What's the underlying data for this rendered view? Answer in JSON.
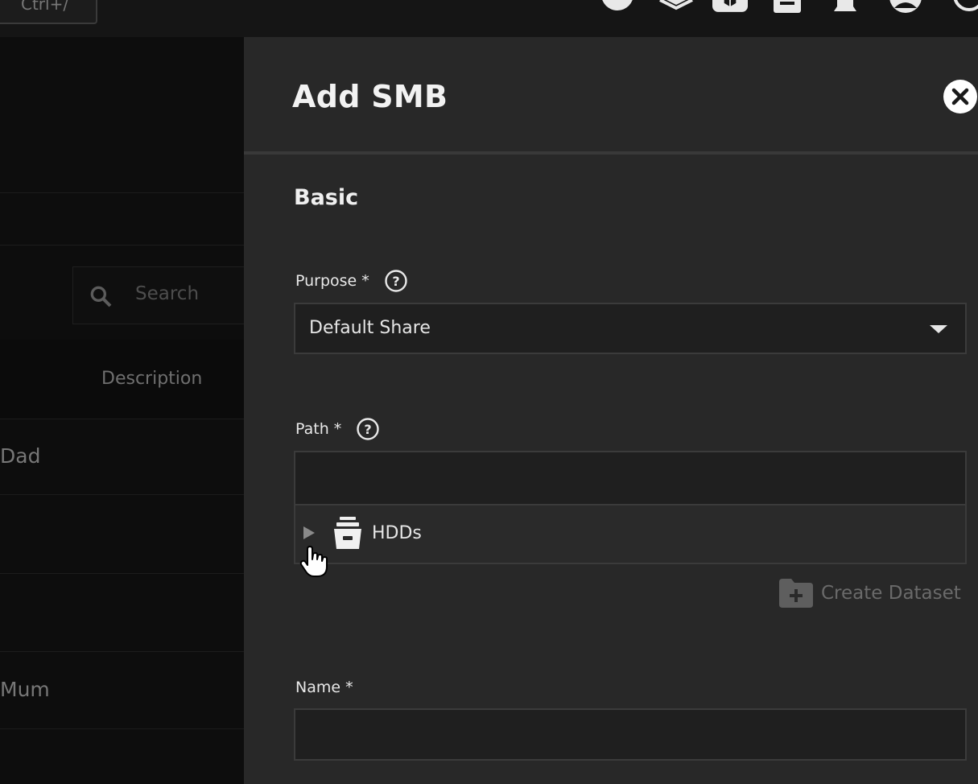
{
  "topbar": {
    "shortcut_hint": "Ctrl+/",
    "icons": [
      "truecommand-icon",
      "jobs-icon",
      "apps-icon",
      "directory-services-icon",
      "notifications-icon",
      "account-icon",
      "power-icon"
    ]
  },
  "background_page": {
    "search_placeholder": "Search",
    "column_description": "Description",
    "rows": [
      "Dad",
      "Mum"
    ]
  },
  "panel": {
    "title": "Add SMB",
    "section_basic": "Basic",
    "purpose": {
      "label": "Purpose *",
      "value": "Default Share"
    },
    "path": {
      "label": "Path *",
      "value": "",
      "tree": [
        {
          "label": "HDDs",
          "icon": "pool-icon",
          "expanded": false
        }
      ]
    },
    "create_dataset_label": "Create Dataset",
    "name": {
      "label": "Name *",
      "value": ""
    }
  },
  "colors": {
    "panel_bg": "#282828",
    "field_bg": "#1f1f1f",
    "disabled_text": "#6a6a6a"
  }
}
